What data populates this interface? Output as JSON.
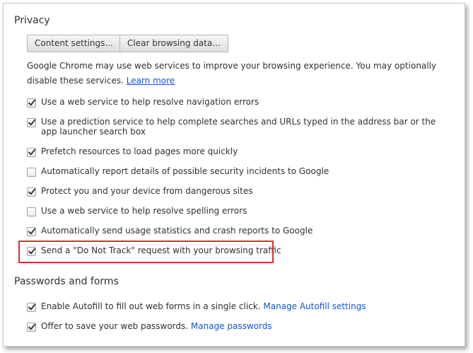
{
  "privacy": {
    "title": "Privacy",
    "content_settings_label": "Content settings...",
    "clear_browsing_label": "Clear browsing data...",
    "description": "Google Chrome may use web services to improve your browsing experience. You may optionally disable these services. ",
    "learn_more": "Learn more",
    "options": [
      {
        "label": "Use a web service to help resolve navigation errors",
        "checked": true
      },
      {
        "label": "Use a prediction service to help complete searches and URLs typed in the address bar or the app launcher search box",
        "checked": true
      },
      {
        "label": "Prefetch resources to load pages more quickly",
        "checked": true
      },
      {
        "label": "Automatically report details of possible security incidents to Google",
        "checked": false
      },
      {
        "label": "Protect you and your device from dangerous sites",
        "checked": true
      },
      {
        "label": "Use a web service to help resolve spelling errors",
        "checked": false
      },
      {
        "label": "Automatically send usage statistics and crash reports to Google",
        "checked": true
      },
      {
        "label": "Send a \"Do Not Track\" request with your browsing traffic",
        "checked": true
      }
    ]
  },
  "passwords": {
    "title": "Passwords and forms",
    "options": [
      {
        "label": "Enable Autofill to fill out web forms in a single click.",
        "link": "Manage Autofill settings",
        "checked": true
      },
      {
        "label": "Offer to save your web passwords.",
        "link": "Manage passwords",
        "checked": true
      }
    ]
  },
  "colors": {
    "highlight": "#d9312e",
    "link": "#1155cc"
  }
}
